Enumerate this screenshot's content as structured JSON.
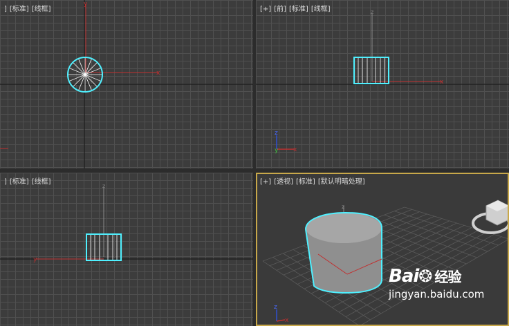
{
  "viewports": {
    "top": {
      "labels": [
        "]",
        "[标准]",
        "[线框]"
      ]
    },
    "front": {
      "labels": [
        "[+]",
        "[前]",
        "[标准]",
        "[线框]"
      ]
    },
    "left": {
      "labels": [
        "]",
        "[标准]",
        "[线框]"
      ]
    },
    "perspective": {
      "labels": [
        "[+]",
        "[透视]",
        "[标准]",
        "[默认明暗处理]"
      ]
    }
  },
  "axis_labels": {
    "x": "x",
    "y": "y",
    "z": "z"
  },
  "watermark": {
    "brand": "Bai",
    "brand2": "经验",
    "url": "jingyan.baidu.com"
  },
  "colors": {
    "selection": "#4ff0ff",
    "axis_x": "#d03030",
    "active_border": "#c8a84a"
  }
}
